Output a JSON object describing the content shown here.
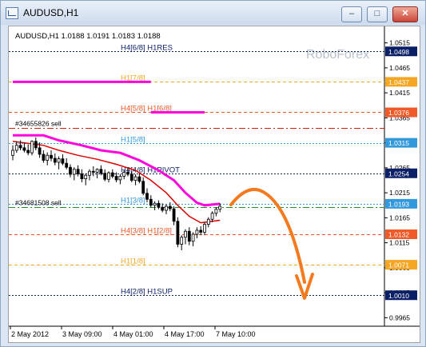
{
  "window": {
    "title": "AUDUSD,H1",
    "controls": {
      "minimize": "–",
      "maximize": "□",
      "close": "✕"
    }
  },
  "chart_data": {
    "type": "candlestick",
    "symbol_info": "AUDUSD,H1  1.0188 1.0191 1.0183 1.0188",
    "watermark": "RoboForex",
    "price_axis_ticks": [
      {
        "value": 1.0515,
        "label": "1.0515"
      },
      {
        "value": 1.0465,
        "label": "1.0465"
      },
      {
        "value": 1.0415,
        "label": "1.0415"
      },
      {
        "value": 1.0365,
        "label": "1.0365"
      },
      {
        "value": 1.0315,
        "label": "1.0315"
      },
      {
        "value": 1.0265,
        "label": "1.0265"
      },
      {
        "value": 1.0215,
        "label": "1.0215"
      },
      {
        "value": 1.0165,
        "label": "1.0165"
      },
      {
        "value": 1.0115,
        "label": "1.0115"
      },
      {
        "value": 1.0065,
        "label": "1.0065"
      },
      {
        "value": 1.0015,
        "label": "1.0015"
      },
      {
        "value": 0.9965,
        "label": "0.9965"
      }
    ],
    "price_labels": [
      {
        "value": 1.0498,
        "label": "1.0498",
        "bg": "#0a1f66",
        "fg": "#ffffff"
      },
      {
        "value": 1.0437,
        "label": "1.0437",
        "bg": "#f5a623",
        "fg": "#ffffff"
      },
      {
        "value": 1.0376,
        "label": "1.0376",
        "bg": "#f05a28",
        "fg": "#ffffff"
      },
      {
        "value": 1.0315,
        "label": "1.0315",
        "bg": "#3399dd",
        "fg": "#ffffff"
      },
      {
        "value": 1.0254,
        "label": "1.0254",
        "bg": "#0a1f66",
        "fg": "#ffffff"
      },
      {
        "value": 1.0193,
        "label": "1.0193",
        "bg": "#3399dd",
        "fg": "#ffffff"
      },
      {
        "value": 1.0132,
        "label": "1.0132",
        "bg": "#f05a28",
        "fg": "#ffffff"
      },
      {
        "value": 1.0071,
        "label": "1.0071",
        "bg": "#f5a623",
        "fg": "#ffffff"
      },
      {
        "value": 1.001,
        "label": "1.0010",
        "bg": "#0a1f66",
        "fg": "#ffffff"
      }
    ],
    "levels": [
      {
        "name": "H4[6/8] H1RES",
        "value": 1.0498,
        "color": "#0a1f66",
        "dash": "2,2"
      },
      {
        "name": "H1[7/8]",
        "value": 1.0437,
        "color": "#f5a623",
        "dash": "4,3"
      },
      {
        "name": "H4[5/8] H1[6/8]",
        "value": 1.0376,
        "color": "#f05a28",
        "dash": "4,3"
      },
      {
        "name": "H1[5/8]",
        "value": 1.0315,
        "color": "#3399dd",
        "dash": "2,2"
      },
      {
        "name": "H4[4/8] H1PIVOT",
        "value": 1.0254,
        "color": "#0a1f66",
        "dash": "2,2"
      },
      {
        "name": "H1[3/8]",
        "value": 1.0193,
        "color": "#3399dd",
        "dash": "2,2"
      },
      {
        "name": "H4[3/8] H1[2/8]",
        "value": 1.0132,
        "color": "#f05a28",
        "dash": "4,3"
      },
      {
        "name": "H1[1/8]",
        "value": 1.0071,
        "color": "#f5a623",
        "dash": "4,3"
      },
      {
        "name": "H4[2/8] H1SUP",
        "value": 1.001,
        "color": "#0a1f66",
        "dash": "2,2"
      }
    ],
    "orders": [
      {
        "label": "#34655826 sell",
        "value": 1.0345,
        "color": "#cc2200",
        "dash": "8,3,2,3"
      },
      {
        "label": "#34681508 sell",
        "value": 1.0187,
        "color": "#228822",
        "dash": "8,3,2,3"
      }
    ],
    "x_axis_labels": [
      "2 May 2012",
      "3 May 09:00",
      "4 May 01:00",
      "4 May 17:00",
      "7 May 10:00"
    ],
    "candles": [
      [
        1.029,
        1.031,
        1.028,
        1.03
      ],
      [
        1.03,
        1.0318,
        1.0295,
        1.031
      ],
      [
        1.031,
        1.032,
        1.03,
        1.0305
      ],
      [
        1.0305,
        1.0315,
        1.0296,
        1.03
      ],
      [
        1.03,
        1.0312,
        1.029,
        1.0295
      ],
      [
        1.0295,
        1.032,
        1.029,
        1.0318
      ],
      [
        1.0318,
        1.0326,
        1.03,
        1.0305
      ],
      [
        1.0305,
        1.0316,
        1.0285,
        1.0292
      ],
      [
        1.0292,
        1.03,
        1.0275,
        1.028
      ],
      [
        1.028,
        1.0296,
        1.027,
        1.029
      ],
      [
        1.029,
        1.03,
        1.0278,
        1.0284
      ],
      [
        1.0284,
        1.0294,
        1.027,
        1.0276
      ],
      [
        1.0276,
        1.0288,
        1.0262,
        1.0283
      ],
      [
        1.0283,
        1.0292,
        1.027,
        1.0274
      ],
      [
        1.0274,
        1.0284,
        1.0262,
        1.0266
      ],
      [
        1.0266,
        1.0272,
        1.0246,
        1.0252
      ],
      [
        1.0252,
        1.0266,
        1.024,
        1.0262
      ],
      [
        1.0262,
        1.027,
        1.0248,
        1.0253
      ],
      [
        1.0253,
        1.0262,
        1.0236,
        1.0243
      ],
      [
        1.0243,
        1.0254,
        1.023,
        1.025
      ],
      [
        1.025,
        1.0262,
        1.024,
        1.0258
      ],
      [
        1.0258,
        1.0268,
        1.0248,
        1.0256
      ],
      [
        1.0256,
        1.0264,
        1.0244,
        1.0262
      ],
      [
        1.0262,
        1.027,
        1.025,
        1.0254
      ],
      [
        1.0254,
        1.0262,
        1.0238,
        1.0242
      ],
      [
        1.0242,
        1.0258,
        1.0236,
        1.0255
      ],
      [
        1.0255,
        1.0262,
        1.0244,
        1.0248
      ],
      [
        1.0248,
        1.0256,
        1.0236,
        1.0241
      ],
      [
        1.0241,
        1.0252,
        1.0232,
        1.0248
      ],
      [
        1.0248,
        1.026,
        1.0242,
        1.0256
      ],
      [
        1.0256,
        1.0266,
        1.0248,
        1.0252
      ],
      [
        1.0252,
        1.0258,
        1.0236,
        1.024
      ],
      [
        1.024,
        1.0252,
        1.023,
        1.0247
      ],
      [
        1.0247,
        1.0254,
        1.0234,
        1.0238
      ],
      [
        1.0238,
        1.0246,
        1.021,
        1.0214
      ],
      [
        1.0214,
        1.0224,
        1.0196,
        1.0202
      ],
      [
        1.0202,
        1.021,
        1.0186,
        1.019
      ],
      [
        1.019,
        1.0198,
        1.018,
        1.0194
      ],
      [
        1.0194,
        1.02,
        1.0182,
        1.0186
      ],
      [
        1.0186,
        1.0194,
        1.0176,
        1.018
      ],
      [
        1.018,
        1.0192,
        1.0172,
        1.0188
      ],
      [
        1.0188,
        1.0196,
        1.0178,
        1.0183
      ],
      [
        1.0183,
        1.0188,
        1.015,
        1.0158
      ],
      [
        1.0158,
        1.0166,
        1.0106,
        1.0112
      ],
      [
        1.0112,
        1.013,
        1.01,
        1.0126
      ],
      [
        1.0126,
        1.0142,
        1.0112,
        1.0138
      ],
      [
        1.0138,
        1.0146,
        1.011,
        1.0118
      ],
      [
        1.0118,
        1.0136,
        1.0108,
        1.0132
      ],
      [
        1.0132,
        1.0146,
        1.0124,
        1.014
      ],
      [
        1.014,
        1.0148,
        1.013,
        1.0136
      ],
      [
        1.0136,
        1.0156,
        1.013,
        1.0152
      ],
      [
        1.0152,
        1.0166,
        1.0146,
        1.0162
      ],
      [
        1.0162,
        1.0178,
        1.0156,
        1.0174
      ],
      [
        1.0174,
        1.0186,
        1.0168,
        1.0182
      ],
      [
        1.0182,
        1.0194,
        1.0176,
        1.0188
      ]
    ],
    "lines": [
      {
        "name": "magenta",
        "color": "#ff00dd",
        "width": 3,
        "segments": [
          [
            [
              0,
              1.0437
            ],
            [
              36,
              1.0437
            ]
          ],
          [
            [
              36,
              1.0376
            ],
            [
              50,
              1.0376
            ]
          ],
          [
            [
              0,
              1.033
            ],
            [
              8,
              1.033
            ],
            [
              12,
              1.032
            ],
            [
              18,
              1.031
            ],
            [
              23,
              1.03
            ],
            [
              28,
              1.0295
            ],
            [
              33,
              1.028
            ],
            [
              38,
              1.026
            ],
            [
              42,
              1.024
            ],
            [
              45,
              1.0215
            ],
            [
              48,
              1.0195
            ],
            [
              50,
              1.019
            ],
            [
              54,
              1.0193
            ]
          ]
        ]
      },
      {
        "name": "red",
        "color": "#dd0000",
        "width": 1.5,
        "segments": [
          [
            [
              0,
              1.0318
            ],
            [
              8,
              1.031
            ],
            [
              12,
              1.03
            ],
            [
              17,
              1.029
            ],
            [
              22,
              1.0282
            ],
            [
              27,
              1.0272
            ],
            [
              32,
              1.026
            ],
            [
              36,
              1.024
            ],
            [
              40,
              1.0215
            ],
            [
              43,
              1.019
            ],
            [
              46,
              1.0168
            ],
            [
              49,
              1.0155
            ],
            [
              54,
              1.016
            ]
          ]
        ]
      }
    ],
    "forecast_arrow": {
      "color": "#f57a1e"
    },
    "ylim": [
      0.9948,
      1.0548
    ]
  }
}
